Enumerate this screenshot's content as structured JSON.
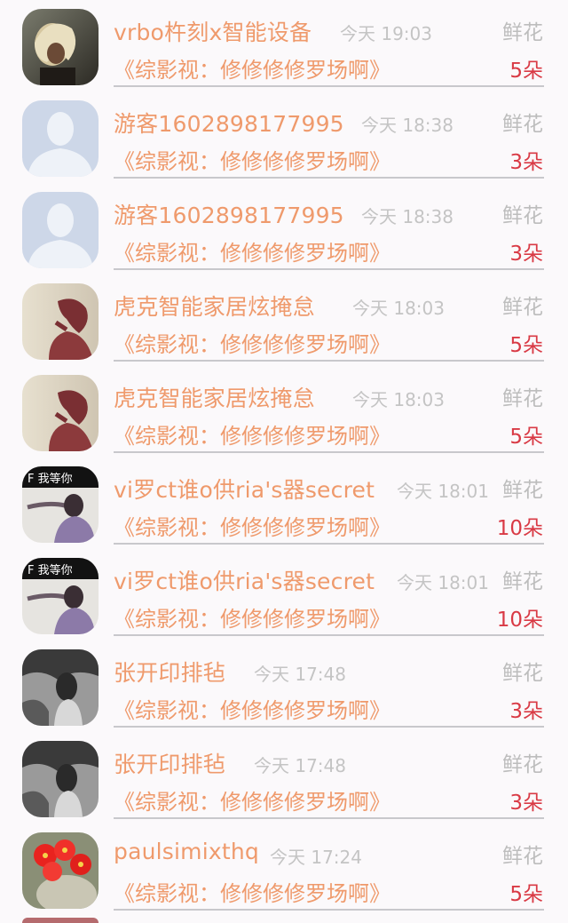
{
  "list": {
    "items": [
      {
        "name": "vrbo杵刻x智能设备",
        "time": "今天 19:03",
        "gift": "鲜花",
        "subtitle": "《综影视：修修修修罗场啊》",
        "count": "5朵",
        "avatar": "girl-hair-photo"
      },
      {
        "name": "游客1602898177995",
        "time": "今天 18:38",
        "gift": "鲜花",
        "subtitle": "《综影视：修修修修罗场啊》",
        "count": "3朵",
        "avatar": "default-user"
      },
      {
        "name": "游客1602898177995",
        "time": "今天 18:38",
        "gift": "鲜花",
        "subtitle": "《综影视：修修修修罗场啊》",
        "count": "3朵",
        "avatar": "default-user"
      },
      {
        "name": "虎克智能家居炫掩怠",
        "time": "今天 18:03",
        "gift": "鲜花",
        "subtitle": "《综影视：修修修修罗场啊》",
        "count": "5朵",
        "avatar": "girl-silhouette-photo"
      },
      {
        "name": "虎克智能家居炫掩怠",
        "time": "今天 18:03",
        "gift": "鲜花",
        "subtitle": "《综影视：修修修修罗场啊》",
        "count": "5朵",
        "avatar": "girl-silhouette-photo"
      },
      {
        "name": "vi罗ct谁o供ria's器secret",
        "time": "今天 18:01",
        "gift": "鲜花",
        "subtitle": "《综影视：修修修修罗场啊》",
        "count": "10朵",
        "avatar": "boy-waiting-photo",
        "avatar_text": "F 我等你"
      },
      {
        "name": "vi罗ct谁o供ria's器secret",
        "time": "今天 18:01",
        "gift": "鲜花",
        "subtitle": "《综影视：修修修修罗场啊》",
        "count": "10朵",
        "avatar": "boy-waiting-photo",
        "avatar_text": "F 我等你"
      },
      {
        "name": "张开印排毡",
        "time": "今天 17:48",
        "gift": "鲜花",
        "subtitle": "《综影视：修修修修罗场啊》",
        "count": "3朵",
        "avatar": "bw-girl-photo"
      },
      {
        "name": "张开印排毡",
        "time": "今天 17:48",
        "gift": "鲜花",
        "subtitle": "《综影视：修修修修罗场啊》",
        "count": "3朵",
        "avatar": "bw-girl-photo"
      },
      {
        "name": "paulsimixthq",
        "time": "今天 17:24",
        "gift": "鲜花",
        "subtitle": "《综影视：修修修修罗场啊》",
        "count": "5朵",
        "avatar": "red-flowers-photo"
      }
    ]
  },
  "colors": {
    "name": "#ef9a6c",
    "time": "#c4c4c4",
    "gift": "#bdbdbd",
    "count": "#d93a45",
    "divider": "#c8c8cc",
    "background": "#fbf9fb"
  }
}
